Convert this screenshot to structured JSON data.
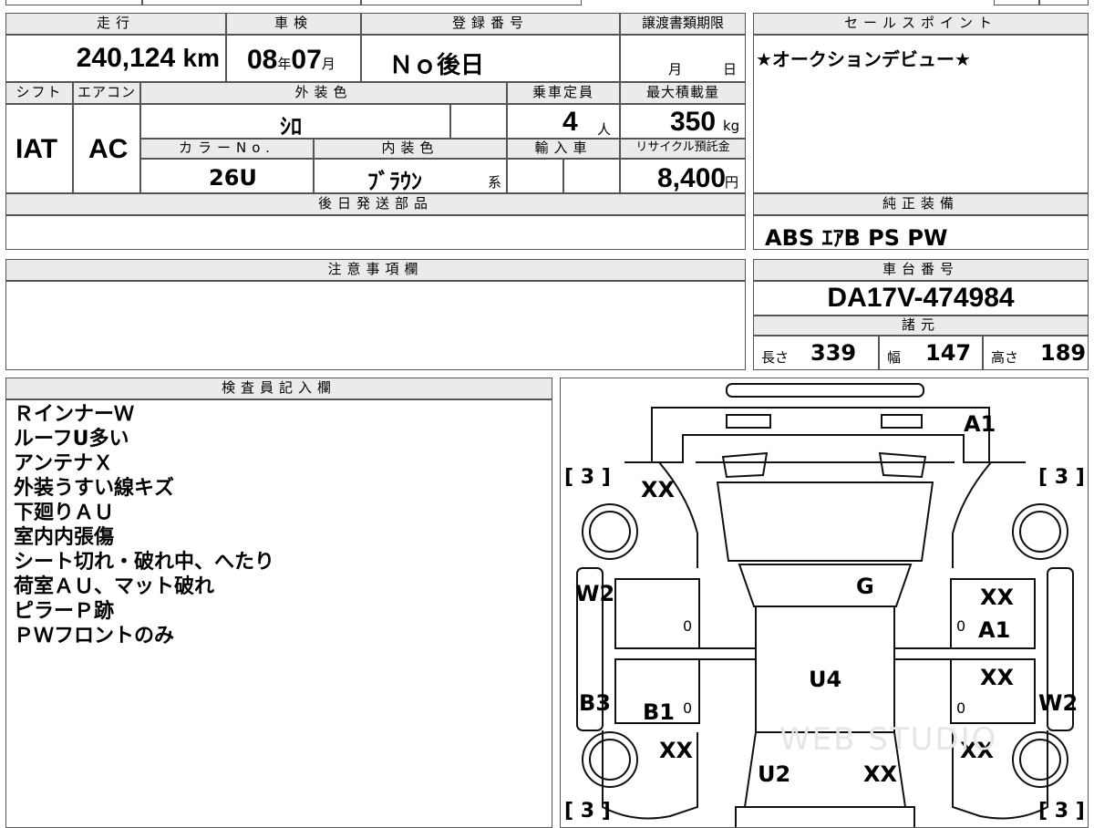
{
  "odometer": {
    "label": "走行",
    "value": "240,124",
    "unit": "km"
  },
  "shaken": {
    "label": "車検",
    "year": "08",
    "year_unit": "年",
    "month": "07",
    "month_unit": "月"
  },
  "registration": {
    "label": "登録番号",
    "value": "Ｎｏ後日"
  },
  "transfer_deadline": {
    "label": "譲渡書類期限",
    "month_unit": "月",
    "day_unit": "日"
  },
  "sales_point": {
    "label": "セールスポイント",
    "text": "★オークションデビュー★"
  },
  "shift": {
    "label": "シフト",
    "value": "IAT"
  },
  "aircon": {
    "label": "エアコン",
    "value": "AC"
  },
  "exterior_color": {
    "label": "外装色",
    "value": "ｼﾛ"
  },
  "capacity": {
    "label": "乗車定員",
    "value": "4",
    "unit": "人"
  },
  "max_load": {
    "label": "最大積載量",
    "value": "350",
    "unit": "kg"
  },
  "color_no": {
    "label": "カラーNo.",
    "value": "26U"
  },
  "interior_color": {
    "label": "内装色",
    "value": "ﾌﾞﾗｳﾝ",
    "suffix": "系"
  },
  "import": {
    "label": "輸入車"
  },
  "recycle": {
    "label": "リサイクル預託金",
    "value": "8,400",
    "unit": "円"
  },
  "later_parts": {
    "label": "後日発送部品",
    "value": ""
  },
  "genuine_equipment": {
    "label": "純正装備",
    "value": "ABS ｴｱB PS PW"
  },
  "caution": {
    "label": "注意事項欄",
    "value": ""
  },
  "chassis": {
    "label": "車台番号",
    "value": "DA17V-474984"
  },
  "specs": {
    "label": "諸元",
    "length_label": "長さ",
    "length": "339",
    "width_label": "幅",
    "width": "147",
    "height_label": "高さ",
    "height": "189"
  },
  "inspector": {
    "label": "検査員記入欄",
    "notes": [
      "ＲインナーＷ",
      "ルーフU多い",
      "アンテナＸ",
      "外装うすい線キズ",
      "下廻りＡＵ",
      "室内内張傷",
      "シート切れ・破れ中、へたり",
      "荷室ＡＵ、マット破れ",
      "ピラーＰ跡",
      "ＰＷフロントのみ"
    ]
  },
  "diagram": {
    "marks": {
      "a1_top": "A1",
      "xx_front_left": "XX",
      "g_hood": "G",
      "xx_front_right_door": "XX",
      "a1_right": "A1",
      "xx_rear_right_door": "XX",
      "w2_left": "W2",
      "w2_right": "W2",
      "u4_roof": "U4",
      "b3_left": "B3",
      "b1": "B1",
      "xx_rear_left": "XX",
      "xx_rear_right": "XX",
      "u2": "U2",
      "xx_rear_center": "XX",
      "zero_1": "0",
      "zero_2": "0",
      "zero_3": "0",
      "zero_4": "0"
    },
    "tire_counts": {
      "front_left": "3",
      "front_right": "3",
      "rear_left": "3",
      "rear_right": "3"
    },
    "watermark": "WEB STUDIO"
  }
}
